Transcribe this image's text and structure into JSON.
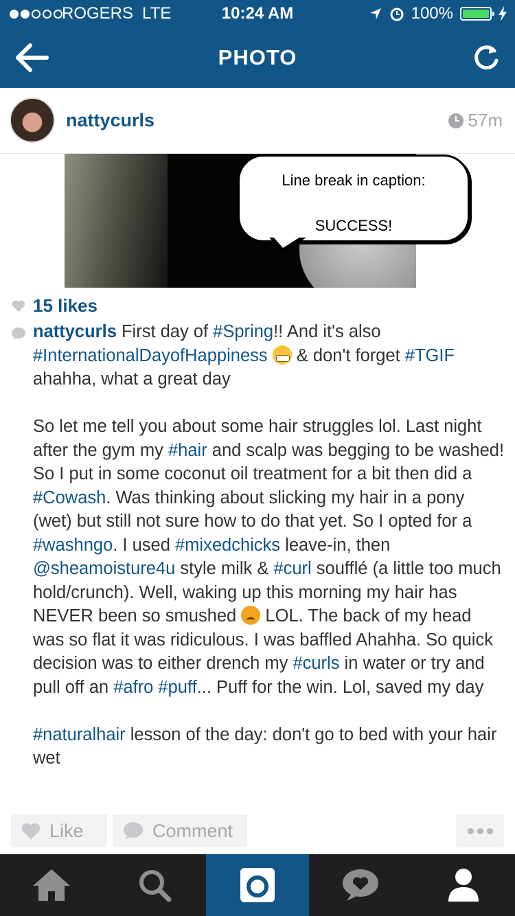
{
  "status_bar": {
    "carrier": "ROGERS",
    "network": "LTE",
    "time": "10:24 AM",
    "battery": "100%",
    "signal_bars": 2,
    "signal_total": 5
  },
  "nav": {
    "title": "PHOTO",
    "back_icon": "arrow-left-icon",
    "refresh_icon": "refresh-icon"
  },
  "post": {
    "username": "nattycurls",
    "time_ago": "57m",
    "photo_caption_lines": [
      "Line break in caption:",
      "SUCCESS!"
    ],
    "likes": "15 likes",
    "caption": {
      "author": "nattycurls",
      "p1": {
        "a": " First day of ",
        "tag_spring": "#Spring",
        "b": "!! And it's also ",
        "tag_happiness": "#InternationalDayofHappiness",
        "c": " & don't forget ",
        "tag_tgif": "#TGIF",
        "d": " ahahha, what a great day"
      },
      "p2": {
        "a": "So let me tell you about some hair struggles lol. Last night after the gym my ",
        "tag_hair": "#hair",
        "b": " and scalp was begging to be washed! So I put in some coconut oil treatment for a bit then did a ",
        "tag_cowash": "#Cowash",
        "c": ". Was thinking about slicking my hair in a pony (wet) but still not sure how to do that yet. So I opted for a ",
        "tag_washngo": "#washngo",
        "d": ". I used ",
        "tag_mixedchicks": "#mixedchicks",
        "e": " leave-in, then ",
        "mention": "@sheamoisture4u",
        "f": " style milk & ",
        "tag_curl": "#curl",
        "g": " soufflé (a little too much hold/crunch). Well, waking up this morning my hair has NEVER been so smushed ",
        "h": " LOL. The back of my head was so flat it was ridiculous. I was baffled Ahahha. So quick decision was to either drench my ",
        "tag_curls": "#curls",
        "i": " in water or try and pull off an ",
        "tag_afro": "#afro",
        "j": " ",
        "tag_puff": "#puff",
        "k": "... Puff for the win. Lol, saved my day"
      },
      "p3": {
        "tag_naturalhair": "#naturalhair",
        "a": " lesson of the day: don't go to bed with your hair wet"
      }
    }
  },
  "actions": {
    "like_label": "Like",
    "comment_label": "Comment",
    "more_icon": "more-icon"
  },
  "tabs": [
    {
      "icon": "home-icon",
      "active": false
    },
    {
      "icon": "search-icon",
      "active": false
    },
    {
      "icon": "camera-icon",
      "active": true
    },
    {
      "icon": "activity-icon",
      "active": false
    },
    {
      "icon": "profile-icon",
      "active": false
    }
  ],
  "colors": {
    "brand_blue": "#125688",
    "tab_bar": "#1f1f1f",
    "muted_gray": "#a5a7aa"
  }
}
